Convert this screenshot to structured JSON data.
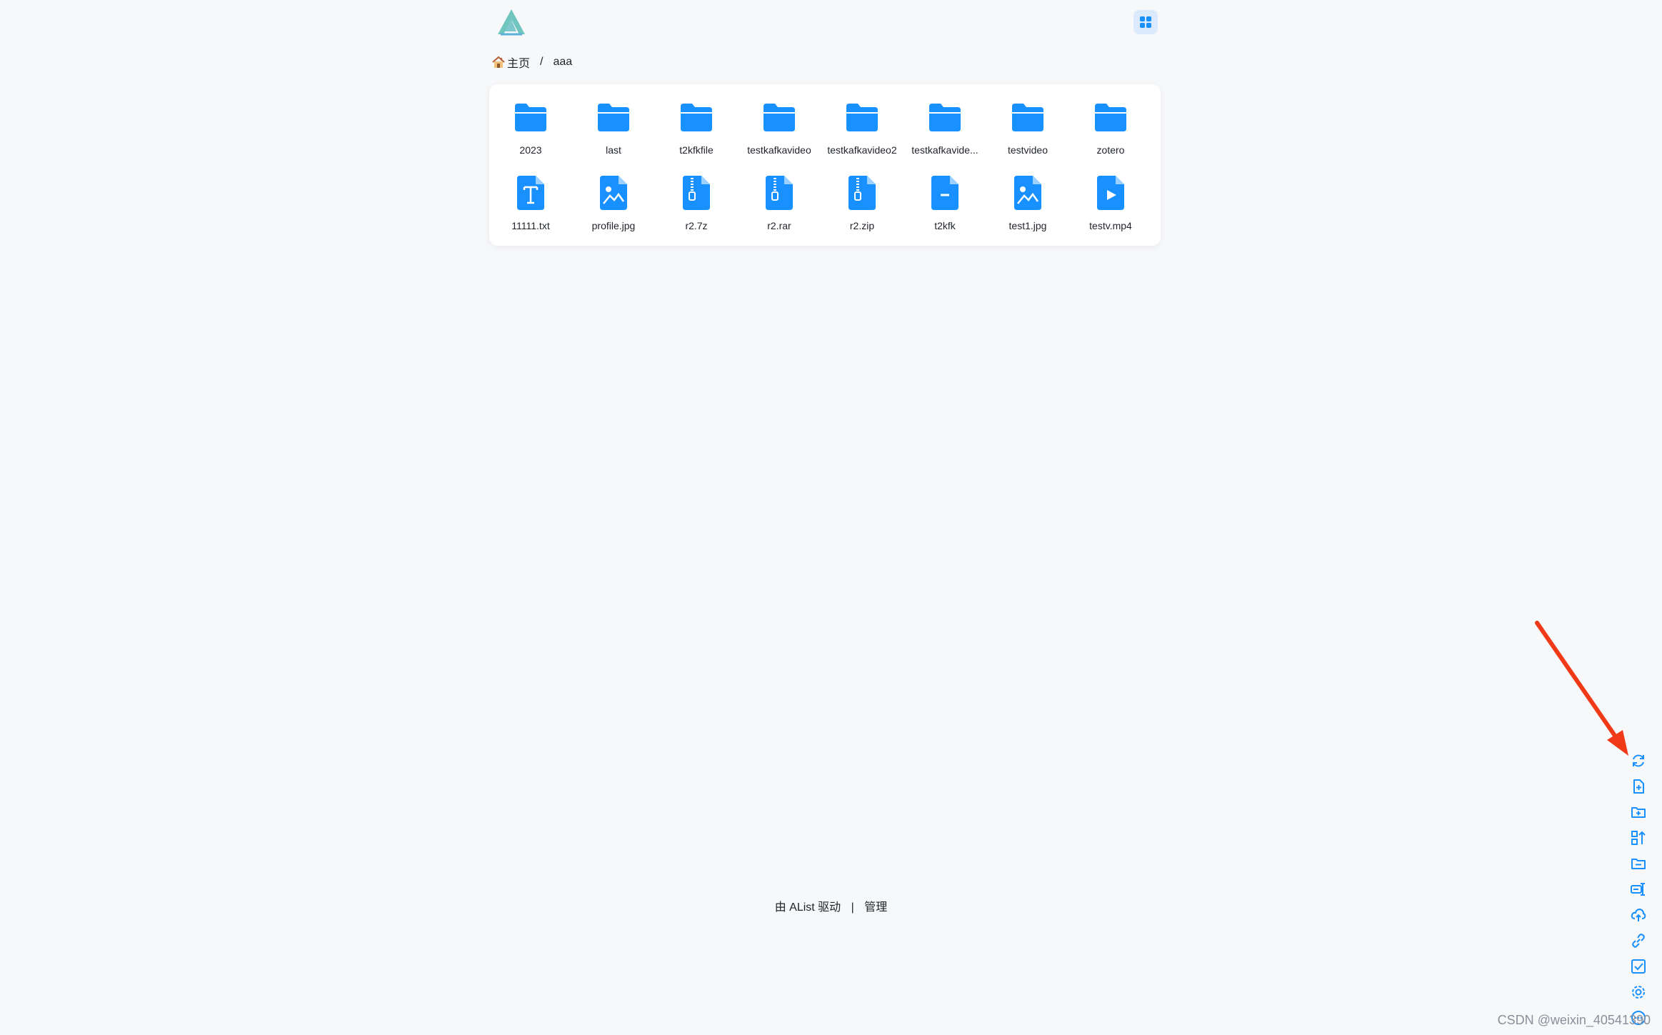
{
  "header": {
    "logo_icon": "alist-logo-icon",
    "layout_toggle_icon": "grid-view-icon"
  },
  "breadcrumb": {
    "home_icon": "house-icon",
    "home_label": "主页",
    "separator": "/",
    "current": "aaa"
  },
  "folders": [
    {
      "name": "2023",
      "icon": "folder-icon"
    },
    {
      "name": "last",
      "icon": "folder-icon"
    },
    {
      "name": "t2kfkfile",
      "icon": "folder-icon"
    },
    {
      "name": "testkafkavideo",
      "icon": "folder-icon"
    },
    {
      "name": "testkafkavideo2",
      "icon": "folder-icon"
    },
    {
      "name": "testkafkavide...",
      "icon": "folder-icon"
    },
    {
      "name": "testvideo",
      "icon": "folder-icon"
    },
    {
      "name": "zotero",
      "icon": "folder-icon"
    }
  ],
  "files": [
    {
      "name": "11111.txt",
      "icon": "text-file-icon"
    },
    {
      "name": "profile.jpg",
      "icon": "image-file-icon"
    },
    {
      "name": "r2.7z",
      "icon": "archive-file-icon"
    },
    {
      "name": "r2.rar",
      "icon": "archive-file-icon"
    },
    {
      "name": "r2.zip",
      "icon": "archive-file-icon"
    },
    {
      "name": "t2kfk",
      "icon": "generic-file-icon"
    },
    {
      "name": "test1.jpg",
      "icon": "image-file-icon"
    },
    {
      "name": "testv.mp4",
      "icon": "video-file-icon"
    }
  ],
  "footer": {
    "powered_by": "由 AList 驱动",
    "separator": "|",
    "manage_link": "管理"
  },
  "toolbar": [
    "refresh-icon",
    "new-file-icon",
    "new-folder-icon",
    "recursive-move-icon",
    "remove-empty-folder-icon",
    "batch-rename-icon",
    "upload-icon",
    "offline-download-icon",
    "multi-select-icon",
    "settings-icon",
    "more-icon"
  ],
  "colors": {
    "accent": "#1890ff",
    "background": "#f7f8fa",
    "annotation_arrow": "#f03a17"
  },
  "watermark": "CSDN @weixin_40541390"
}
